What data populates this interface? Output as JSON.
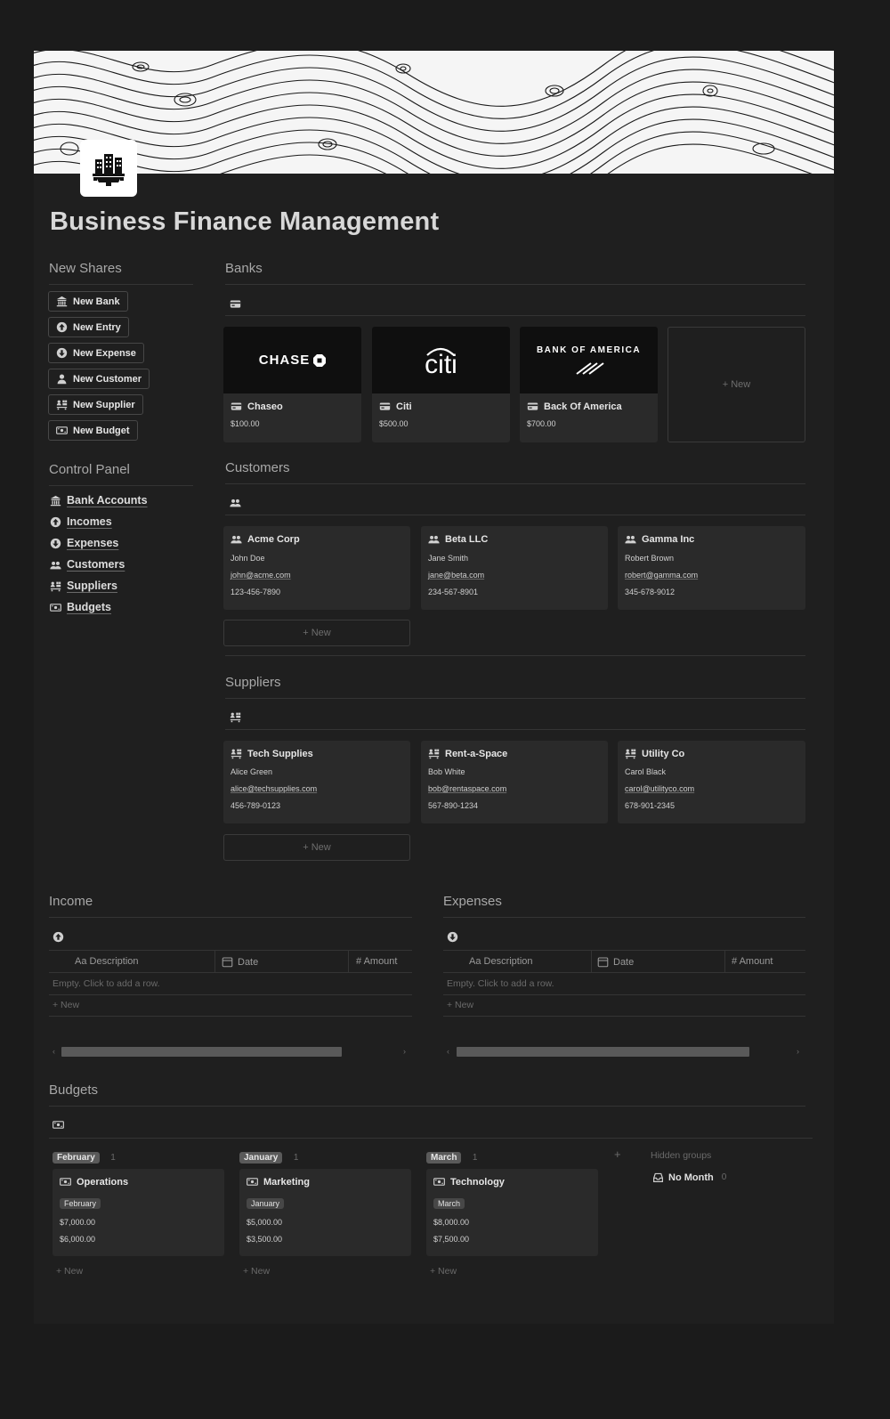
{
  "page": {
    "title": "Business Finance Management"
  },
  "new_shares": {
    "heading": "New Shares",
    "buttons": [
      {
        "label": "New Bank",
        "icon": "bank-icon"
      },
      {
        "label": "New Entry",
        "icon": "arrow-up-circle-icon"
      },
      {
        "label": "New Expense",
        "icon": "arrow-down-circle-icon"
      },
      {
        "label": "New Customer",
        "icon": "person-icon"
      },
      {
        "label": "New Supplier",
        "icon": "supplier-icon"
      },
      {
        "label": "New Budget",
        "icon": "money-icon"
      }
    ]
  },
  "control_panel": {
    "heading": "Control Panel",
    "items": [
      {
        "label": "Bank Accounts",
        "icon": "bank-icon"
      },
      {
        "label": "Incomes",
        "icon": "arrow-up-circle-icon"
      },
      {
        "label": "Expenses",
        "icon": "arrow-down-circle-icon"
      },
      {
        "label": "Customers",
        "icon": "people-icon"
      },
      {
        "label": "Suppliers",
        "icon": "supplier-icon"
      },
      {
        "label": "Budgets",
        "icon": "money-icon"
      }
    ]
  },
  "banks": {
    "heading": "Banks",
    "new_label": "+ New",
    "cards": [
      {
        "name": "Chaseo",
        "amount": "$100.00",
        "logo": "CHASE"
      },
      {
        "name": "Citi",
        "amount": "$500.00",
        "logo": "citi"
      },
      {
        "name": "Back Of America",
        "amount": "$700.00",
        "logo": "BANK OF AMERICA"
      }
    ]
  },
  "customers": {
    "heading": "Customers",
    "new_label": "+ New",
    "cards": [
      {
        "name": "Acme Corp",
        "contact": "John Doe",
        "email": "john@acme.com",
        "phone": "123-456-7890"
      },
      {
        "name": "Beta LLC",
        "contact": "Jane Smith",
        "email": "jane@beta.com",
        "phone": "234-567-8901"
      },
      {
        "name": "Gamma Inc",
        "contact": "Robert Brown",
        "email": "robert@gamma.com",
        "phone": "345-678-9012"
      }
    ]
  },
  "suppliers": {
    "heading": "Suppliers",
    "new_label": "+ New",
    "cards": [
      {
        "name": "Tech Supplies",
        "contact": "Alice Green",
        "email": "alice@techsupplies.com",
        "phone": "456-789-0123"
      },
      {
        "name": "Rent-a-Space",
        "contact": "Bob White",
        "email": "bob@rentaspace.com",
        "phone": "567-890-1234"
      },
      {
        "name": "Utility Co",
        "contact": "Carol Black",
        "email": "carol@utilityco.com",
        "phone": "678-901-2345"
      }
    ]
  },
  "income": {
    "heading": "Income",
    "columns": [
      "Aa Description",
      "Date",
      "# Amount"
    ],
    "empty_text": "Empty. Click to add a row.",
    "new_label": "+ New"
  },
  "expenses": {
    "heading": "Expenses",
    "columns": [
      "Aa Description",
      "Date",
      "# Amount"
    ],
    "empty_text": "Empty. Click to add a row.",
    "new_label": "+ New"
  },
  "budgets": {
    "heading": "Budgets",
    "groups": [
      {
        "month": "February",
        "count": "1",
        "item": "Operations",
        "tag": "February",
        "v1": "$7,000.00",
        "v2": "$6,000.00"
      },
      {
        "month": "January",
        "count": "1",
        "item": "Marketing",
        "tag": "January",
        "v1": "$5,000.00",
        "v2": "$3,500.00"
      },
      {
        "month": "March",
        "count": "1",
        "item": "Technology",
        "tag": "March",
        "v1": "$8,000.00",
        "v2": "$7,500.00"
      }
    ],
    "new_label": "+ New",
    "add_group": "+",
    "hidden_groups": "Hidden groups",
    "no_month": "No Month",
    "no_month_count": "0"
  }
}
